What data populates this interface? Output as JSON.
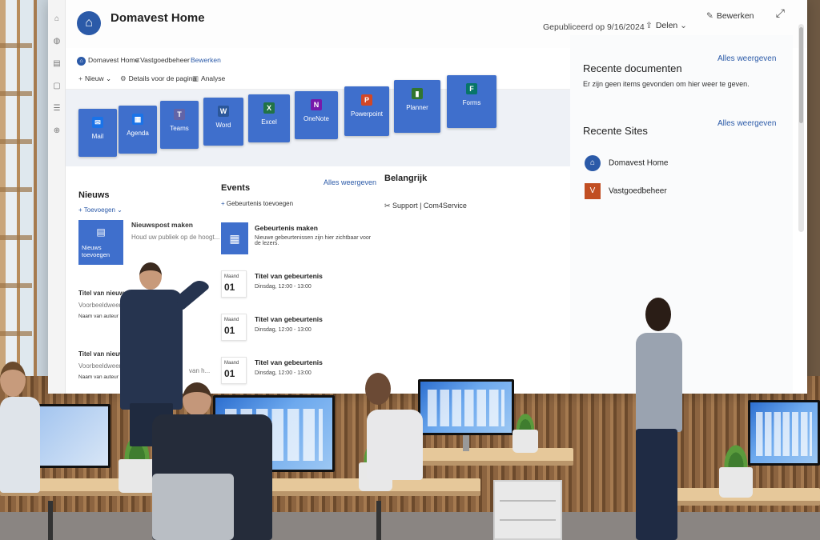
{
  "site": {
    "title": "Domavest Home",
    "published": "Gepubliceerd op 9/16/2024",
    "share_label": "Delen",
    "edit_label": "Bewerken"
  },
  "nav": {
    "items": [
      "Domavest Home",
      "Vastgoedbeheer",
      "Bewerken"
    ]
  },
  "command_bar": {
    "new_label": "Nieuw",
    "details_label": "Details voor de pagina",
    "analytics_label": "Analyse"
  },
  "app_tiles": [
    {
      "label": "Mail",
      "icon": "mail-icon",
      "color": "#1a73e8"
    },
    {
      "label": "Agenda",
      "icon": "calendar-icon",
      "color": "#1a73e8"
    },
    {
      "label": "Teams",
      "icon": "teams-icon",
      "color": "#6264a7"
    },
    {
      "label": "Word",
      "icon": "word-icon",
      "color": "#2b579a"
    },
    {
      "label": "Excel",
      "icon": "excel-icon",
      "color": "#217346"
    },
    {
      "label": "OneNote",
      "icon": "onenote-icon",
      "color": "#7719aa"
    },
    {
      "label": "Powerpoint",
      "icon": "powerpoint-icon",
      "color": "#d24726"
    },
    {
      "label": "Planner",
      "icon": "planner-icon",
      "color": "#31752f"
    },
    {
      "label": "Forms",
      "icon": "forms-icon",
      "color": "#077568"
    }
  ],
  "news": {
    "title": "Nieuws",
    "add_label": "Toevoegen",
    "tile_label": "Nieuws toevoegen",
    "make_title": "Nieuwspost maken",
    "make_desc": "Houd uw publiek op de hoogt...",
    "post1_title": "Titel van nieuwspost",
    "post1_desc": "Voorbeeldweergave waa",
    "post1_author": "Naam van auteur Een",
    "post2_title": "Titel van nieuw",
    "post2_desc": "Voorbeeldweerg",
    "post2_author": "Naam van auteur",
    "post2_desc_tail": "van h..."
  },
  "events": {
    "title": "Events",
    "see_all": "Alles weergeven",
    "add_label": "Gebeurtenis toevoegen",
    "make_title": "Gebeurtenis maken",
    "make_desc": "Nieuwe gebeurtenissen zijn hier zichtbaar voor de lezers.",
    "items": [
      {
        "month": "Maand",
        "day": "01",
        "title": "Titel van gebeurtenis",
        "time": "Dinsdag, 12:00 - 13:00"
      },
      {
        "month": "Maand",
        "day": "01",
        "title": "Titel van gebeurtenis",
        "time": "Dinsdag, 12:00 - 13:00"
      },
      {
        "month": "Maand",
        "day": "01",
        "title": "Titel van gebeurtenis",
        "time": "Dinsdag, 12:00 - 13:00"
      }
    ]
  },
  "important": {
    "title": "Belangrijk",
    "link_label": "Support | Com4Service"
  },
  "recent_docs": {
    "title": "Recente documenten",
    "see_all": "Alles weergeven",
    "empty": "Er zijn geen items gevonden om hier weer te geven."
  },
  "recent_sites": {
    "title": "Recente Sites",
    "see_all": "Alles weergeven",
    "items": [
      {
        "name": "Domavest Home",
        "icon": "home-icon"
      },
      {
        "name": "Vastgoedbeheer",
        "icon": "V"
      }
    ]
  }
}
